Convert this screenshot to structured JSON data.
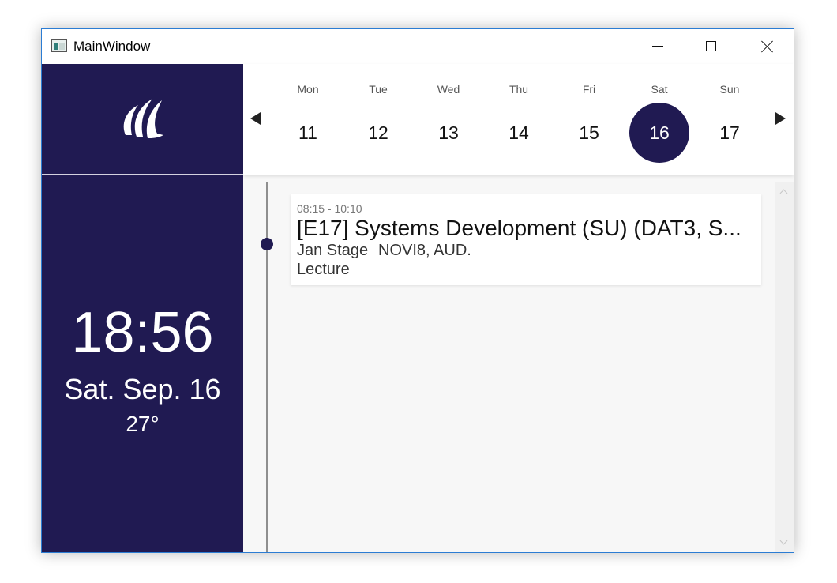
{
  "window": {
    "title": "MainWindow"
  },
  "sidebar": {
    "logo_icon": "university-logo-icon",
    "time": "18:56",
    "date": "Sat. Sep. 16",
    "temperature": "27°"
  },
  "week": {
    "days": [
      {
        "name": "Mon",
        "number": "11"
      },
      {
        "name": "Tue",
        "number": "12"
      },
      {
        "name": "Wed",
        "number": "13"
      },
      {
        "name": "Thu",
        "number": "14"
      },
      {
        "name": "Fri",
        "number": "15"
      },
      {
        "name": "Sat",
        "number": "16",
        "selected": true
      },
      {
        "name": "Sun",
        "number": "17"
      }
    ],
    "prev_icon": "triangle-left-icon",
    "next_icon": "triangle-right-icon"
  },
  "events": [
    {
      "time": "08:15 - 10:10",
      "title": "[E17] Systems Development (SU) (DAT3, S...",
      "lecturer": "Jan Stage",
      "room": "NOVI8, AUD.",
      "type": "Lecture"
    }
  ],
  "colors": {
    "primary": "#201a52",
    "window_border": "#2b7cd3",
    "schedule_bg": "#f7f7f7"
  }
}
